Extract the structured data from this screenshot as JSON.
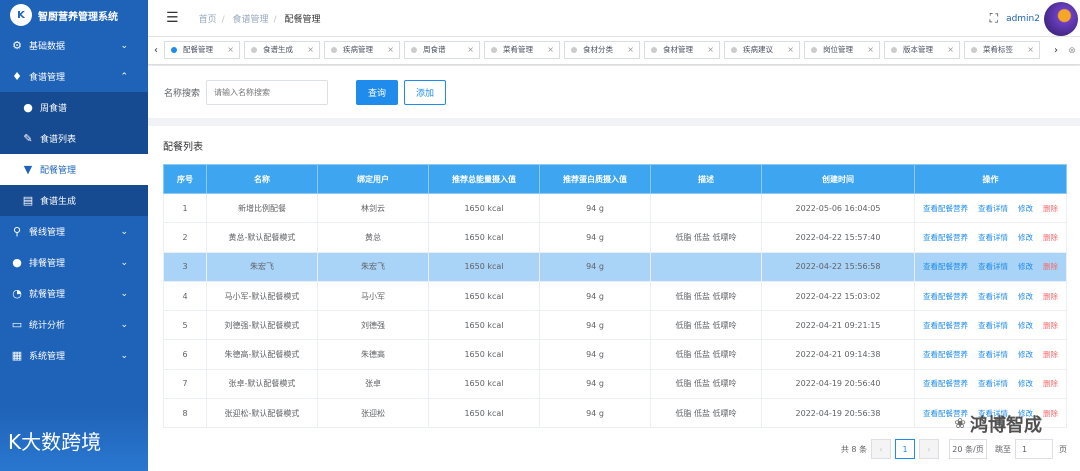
{
  "app": {
    "title": "智厨营养管理系统",
    "logo_text": "K"
  },
  "sidebar": {
    "items": [
      {
        "icon": "gear-icon",
        "glyph": "⚙",
        "label": "基础数据",
        "chev": "⌄"
      },
      {
        "icon": "drop-icon",
        "glyph": "♦",
        "label": "食谱管理",
        "chev": "⌃"
      },
      {
        "icon": "pin-icon",
        "glyph": "●",
        "label": "周食谱",
        "sub": true
      },
      {
        "icon": "pen-icon",
        "glyph": "✎",
        "label": "食谱列表",
        "sub": true
      },
      {
        "icon": "funnel-icon",
        "glyph": "▼",
        "label": "配餐管理",
        "sub": true,
        "active": true
      },
      {
        "icon": "book-icon",
        "glyph": "▤",
        "label": "食谱生成",
        "sub": true
      },
      {
        "icon": "search-icon",
        "glyph": "⚲",
        "label": "餐线管理",
        "chev": "⌄"
      },
      {
        "icon": "circle-icon",
        "glyph": "●",
        "label": "排餐管理",
        "chev": "⌄"
      },
      {
        "icon": "dashboard-icon",
        "glyph": "◔",
        "label": "就餐管理",
        "chev": "⌄"
      },
      {
        "icon": "card-icon",
        "glyph": "▭",
        "label": "统计分析",
        "chev": "⌄"
      },
      {
        "icon": "grid-icon",
        "glyph": "▦",
        "label": "系统管理",
        "chev": "⌄"
      }
    ],
    "footer_text": "K大数跨境"
  },
  "navbar": {
    "menu_glyph": "☰",
    "breadcrumb": [
      "首页",
      "食谱管理",
      "配餐管理"
    ],
    "fullscreen_glyph": "⛶",
    "username": "admin2"
  },
  "tags": {
    "left_arrow": "‹",
    "right_arrow": "›",
    "close_all": "⊗",
    "close_glyph": "×",
    "items": [
      "配餐管理",
      "食谱生成",
      "疾病管理",
      "周食谱",
      "菜肴管理",
      "食材分类",
      "食材管理",
      "疾病建议",
      "岗位管理",
      "版本管理",
      "菜肴标签"
    ]
  },
  "search": {
    "label": "名称搜索",
    "placeholder": "请输入名称搜索",
    "query_label": "查询",
    "add_label": "添加"
  },
  "list": {
    "title": "配餐列表",
    "columns": [
      "序号",
      "名称",
      "绑定用户",
      "推荐总能量摄入值",
      "推荐蛋白质摄入值",
      "描述",
      "创建时间",
      "操作"
    ],
    "rows": [
      {
        "no": "1",
        "name": "新增比例配餐",
        "user": "林剑云",
        "energy": "1650 kcal",
        "protein": "94 g",
        "desc": "",
        "time": "2022-05-06 16:04:05"
      },
      {
        "no": "2",
        "name": "黄总-默认配餐模式",
        "user": "黄总",
        "energy": "1650 kcal",
        "protein": "94 g",
        "desc": "低脂 低盐 低嘌呤",
        "time": "2022-04-22 15:57:40"
      },
      {
        "no": "3",
        "name": "朱宏飞",
        "user": "朱宏飞",
        "energy": "1650 kcal",
        "protein": "94 g",
        "desc": "",
        "time": "2022-04-22 15:56:58",
        "selected": true
      },
      {
        "no": "4",
        "name": "马小军-默认配餐模式",
        "user": "马小军",
        "energy": "1650 kcal",
        "protein": "94 g",
        "desc": "低脂 低盐 低嘌呤",
        "time": "2022-04-22 15:03:02"
      },
      {
        "no": "5",
        "name": "刘德强-默认配餐模式",
        "user": "刘德强",
        "energy": "1650 kcal",
        "protein": "94 g",
        "desc": "低脂 低盐 低嘌呤",
        "time": "2022-04-21 09:21:15"
      },
      {
        "no": "6",
        "name": "朱德高-默认配餐模式",
        "user": "朱德高",
        "energy": "1650 kcal",
        "protein": "94 g",
        "desc": "低脂 低盐 低嘌呤",
        "time": "2022-04-21 09:14:38"
      },
      {
        "no": "7",
        "name": "张卓-默认配餐模式",
        "user": "张卓",
        "energy": "1650 kcal",
        "protein": "94 g",
        "desc": "低脂 低盐 低嘌呤",
        "time": "2022-04-19 20:56:40"
      },
      {
        "no": "8",
        "name": "张迎松-默认配餐模式",
        "user": "张迎松",
        "energy": "1650 kcal",
        "protein": "94 g",
        "desc": "低脂 低盐 低嘌呤",
        "time": "2022-04-19 20:56:38"
      }
    ],
    "ops": {
      "nutrition": "查看配餐营养",
      "detail": "查看详情",
      "edit": "修改",
      "delete": "删除"
    }
  },
  "pager": {
    "total": "共 8 条",
    "prev": "‹",
    "next": "›",
    "current": "1",
    "size": "20 条/页",
    "goto": "跳至",
    "goto_value": "1",
    "unit": "页"
  },
  "watermark": {
    "glyph": "❀",
    "text": "鸿博智成"
  },
  "colors": {
    "primary": "#1f8ceb",
    "sidebar": "#1f63b8",
    "header": "#3ea5f1",
    "danger": "#f56c6c",
    "selected_row": "#a9d3f7"
  }
}
